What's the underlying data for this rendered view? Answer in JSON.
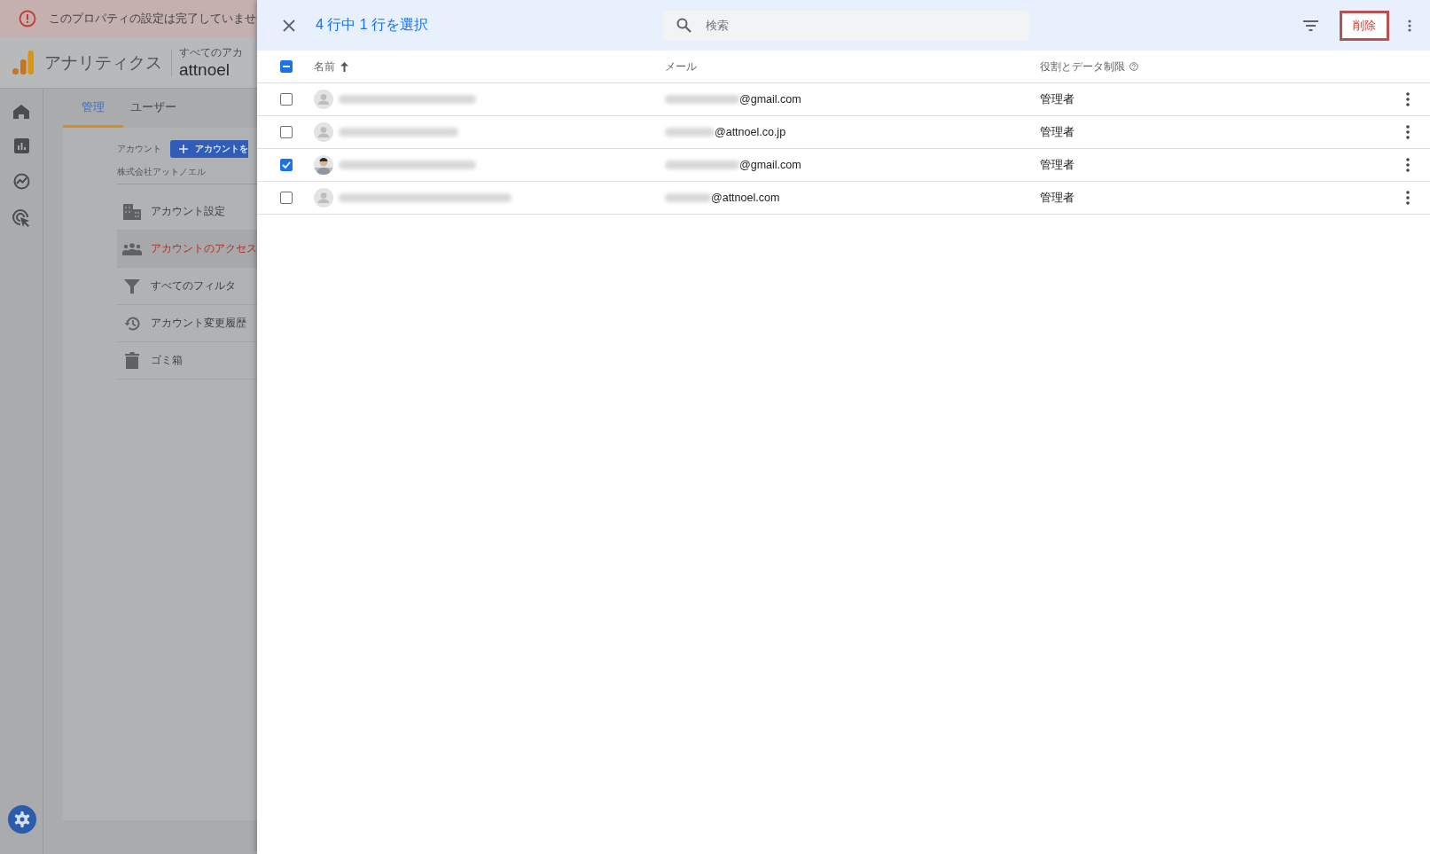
{
  "banner": {
    "text": "このプロパティの設定は完了していませ"
  },
  "app": {
    "product": "アナリティクス",
    "breadcrumb": "すべてのアカ",
    "account": "attnoel"
  },
  "admin_tabs": [
    {
      "label": "管理",
      "selected": true
    },
    {
      "label": "ユーザー",
      "selected": false
    }
  ],
  "account_section": {
    "label": "アカウント",
    "create_button": "アカウントを",
    "account_name": "株式会社アットノエル"
  },
  "menu": [
    {
      "kind": "building",
      "label": "アカウント設定",
      "selected": false
    },
    {
      "kind": "people",
      "label": "アカウントのアクセス",
      "selected": true
    },
    {
      "kind": "filter",
      "label": "すべてのフィルタ",
      "selected": false
    },
    {
      "kind": "history",
      "label": "アカウント変更履歴",
      "selected": false
    },
    {
      "kind": "trash",
      "label": "ゴミ箱",
      "selected": false
    }
  ],
  "drawer": {
    "title": "4 行中 1 行を選択",
    "search": {
      "placeholder": "検索"
    },
    "delete_button": {
      "label": "削除",
      "highlighted": true
    },
    "select_all": {
      "indeterminate": true
    },
    "columns": [
      {
        "label": "名前",
        "sorted": true
      },
      {
        "label": "メール",
        "sorted": false
      },
      {
        "label": "役割とデータ制限",
        "sorted": false
      }
    ],
    "rows": [
      {
        "checked": false,
        "has_photo": false,
        "email_domain": "@gmail.com",
        "role": "管理者"
      },
      {
        "checked": false,
        "has_photo": false,
        "email_domain": "@attnoel.co.jp",
        "role": "管理者"
      },
      {
        "checked": true,
        "has_photo": true,
        "email_domain": "@gmail.com",
        "role": "管理者"
      },
      {
        "checked": false,
        "has_photo": false,
        "email_domain": "@attnoel.com",
        "role": "管理者"
      }
    ]
  }
}
